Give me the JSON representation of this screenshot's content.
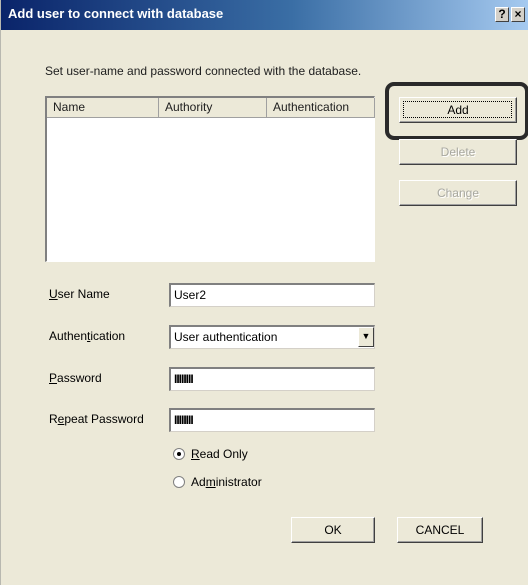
{
  "window": {
    "title": "Add user to connect with database",
    "help_glyph": "?",
    "close_glyph": "×"
  },
  "instruction": "Set user-name and password connected with the database.",
  "list": {
    "columns": [
      "Name",
      "Authority",
      "Authentication"
    ],
    "rows": []
  },
  "buttons": {
    "add": "Add",
    "delete": "Delete",
    "change": "Change",
    "ok": "OK",
    "cancel": "CANCEL"
  },
  "fields": {
    "user_name": {
      "label_prefix": "",
      "label_key": "U",
      "label_rest": "ser Name",
      "value": "User2"
    },
    "authentication": {
      "label_prefix": "Authen",
      "label_key": "t",
      "label_rest": "ication",
      "value": "User authentication",
      "arrow": "▼"
    },
    "password": {
      "label_prefix": "",
      "label_key": "P",
      "label_rest": "assword",
      "value": "IIIIIIII"
    },
    "repeat_password": {
      "label_prefix": "R",
      "label_key": "e",
      "label_rest": "peat Password",
      "value": "IIIIIIII"
    }
  },
  "access": {
    "read_only": {
      "label_prefix": "",
      "label_key": "R",
      "label_rest": "ead Only",
      "checked": true
    },
    "administrator": {
      "label_prefix": "Ad",
      "label_key": "m",
      "label_rest": "inistrator",
      "checked": false
    }
  }
}
